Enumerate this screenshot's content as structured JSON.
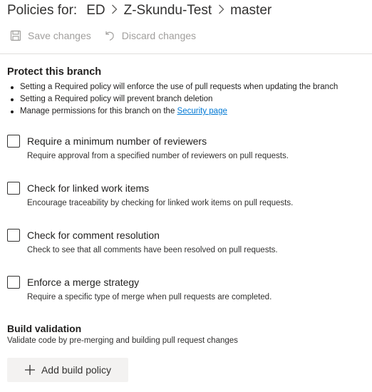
{
  "header": {
    "title": "Policies for:",
    "breadcrumb": [
      "ED",
      "Z-Skundu-Test",
      "master"
    ],
    "separator": ">"
  },
  "toolbar": {
    "save_label": "Save changes",
    "save_icon": "save-icon",
    "discard_label": "Discard changes",
    "discard_icon": "undo-icon"
  },
  "protect": {
    "title": "Protect this branch",
    "bullets": [
      "Setting a Required policy will enforce the use of pull requests when updating the branch",
      "Setting a Required policy will prevent branch deletion",
      "Manage permissions for this branch on the "
    ],
    "security_link": "Security page"
  },
  "policies": [
    {
      "label": "Require a minimum number of reviewers",
      "description": "Require approval from a specified number of reviewers on pull requests.",
      "checked": false
    },
    {
      "label": "Check for linked work items",
      "description": "Encourage traceability by checking for linked work items on pull requests.",
      "checked": false
    },
    {
      "label": "Check for comment resolution",
      "description": "Check to see that all comments have been resolved on pull requests.",
      "checked": false
    },
    {
      "label": "Enforce a merge strategy",
      "description": "Require a specific type of merge when pull requests are completed.",
      "checked": false
    }
  ],
  "build_validation": {
    "title": "Build validation",
    "description": "Validate code by pre-merging and building pull request changes",
    "add_button_label": "Add build policy",
    "add_icon": "plus-icon"
  },
  "colors": {
    "link": "#0078d4",
    "disabled_text": "#a19f9d",
    "button_bg": "#f3f2f1"
  }
}
